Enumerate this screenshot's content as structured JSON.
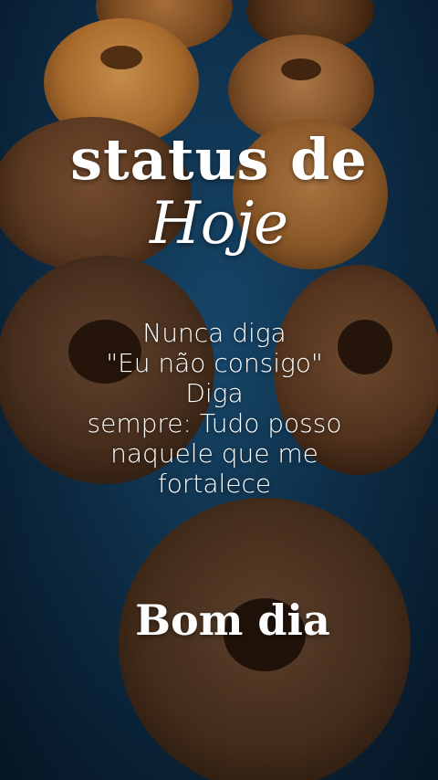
{
  "title": "status de",
  "subtitle_script": "Hoje",
  "quote_lines": [
    "Nunca diga",
    "\"Eu não consigo\"",
    "Diga",
    "sempre: Tudo posso",
    "naquele que me",
    "fortalece"
  ],
  "greeting": "Bom dia",
  "colors": {
    "text": "#ffffff",
    "background": "#123b5c"
  }
}
